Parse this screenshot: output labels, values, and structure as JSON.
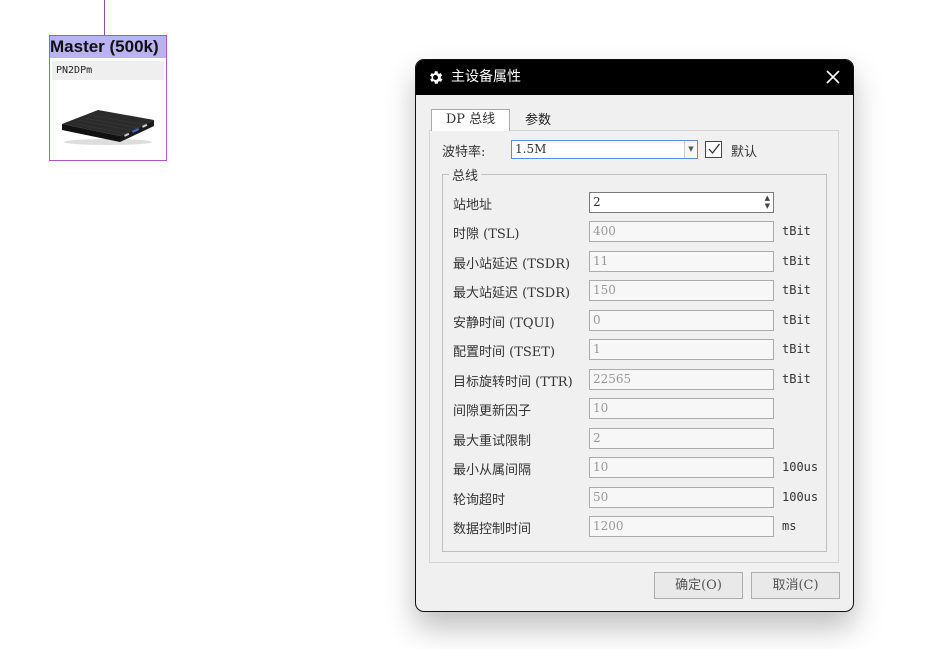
{
  "master_node": {
    "title": "Master (500k)",
    "subtitle": "PN2DPm"
  },
  "dialog": {
    "title": "主设备属性",
    "tabs": [
      {
        "label": "DP 总线"
      },
      {
        "label": "参数"
      }
    ],
    "baud_label": "波特率:",
    "baud_value": "1.5M",
    "default_label": "默认",
    "default_checked": true,
    "group_title": "总线",
    "rows": [
      {
        "label": "站地址",
        "value": "2",
        "unit": ""
      },
      {
        "label": "时隙 (TSL)",
        "value": "400",
        "unit": "tBit"
      },
      {
        "label": "最小站延迟 (TSDR)",
        "value": "11",
        "unit": "tBit"
      },
      {
        "label": "最大站延迟 (TSDR)",
        "value": "150",
        "unit": "tBit"
      },
      {
        "label": "安静时间 (TQUI)",
        "value": "0",
        "unit": "tBit"
      },
      {
        "label": "配置时间 (TSET)",
        "value": "1",
        "unit": "tBit"
      },
      {
        "label": "目标旋转时间 (TTR)",
        "value": "22565",
        "unit": "tBit"
      },
      {
        "label": "间隙更新因子",
        "value": "10",
        "unit": ""
      },
      {
        "label": "最大重试限制",
        "value": "2",
        "unit": ""
      },
      {
        "label": "最小从属间隔",
        "value": "10",
        "unit": "100us"
      },
      {
        "label": "轮询超时",
        "value": "50",
        "unit": "100us"
      },
      {
        "label": "数据控制时间",
        "value": "1200",
        "unit": "ms"
      }
    ],
    "ok_label": "确定(O)",
    "cancel_label": "取消(C)"
  }
}
